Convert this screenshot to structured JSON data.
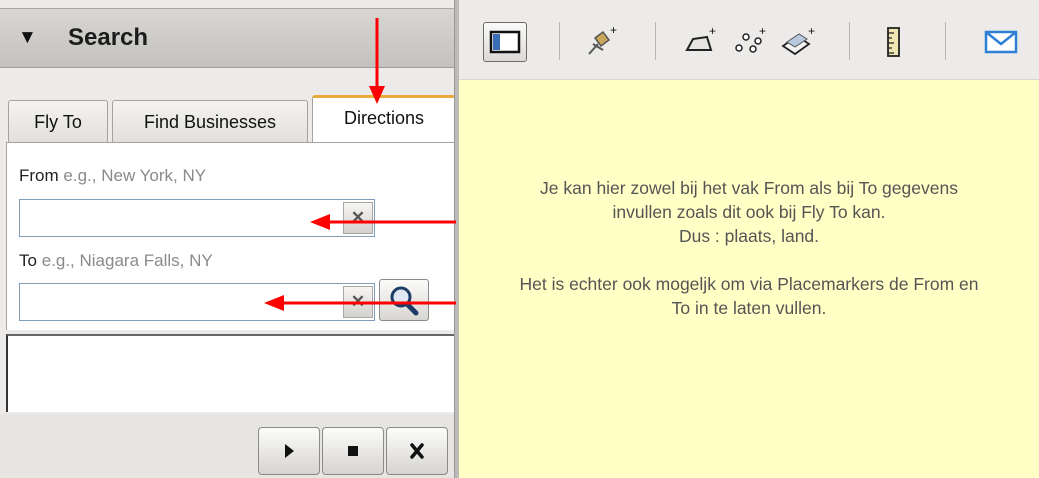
{
  "search_panel": {
    "title": "Search",
    "tabs": [
      "Fly To",
      "Find Businesses",
      "Directions"
    ],
    "active_tab": "Directions",
    "from": {
      "label": "From",
      "hint": "e.g., New York, NY",
      "value": ""
    },
    "to": {
      "label": "To",
      "hint": "e.g., Niagara Falls, NY",
      "value": ""
    }
  },
  "icons": {
    "collapse": "triangle-down-icon",
    "dropdown_clear": "x-icon",
    "search": "magnifier-icon",
    "play": "play-icon",
    "stop": "stop-icon",
    "close": "close-icon"
  },
  "toolbar": {
    "buttons": [
      "sidebar-toggle-icon",
      "add-placemark-icon",
      "add-polygon-icon",
      "add-path-icon",
      "add-image-overlay-icon",
      "ruler-icon",
      "email-icon"
    ]
  },
  "note": {
    "lines": [
      "Je kan hier zowel bij het vak From als bij To  gegevens",
      "invullen zoals dit ook bij Fly To kan.",
      "Dus : plaats, land.",
      "",
      "Het is echter ook mogeljk om via Placemarkers de From en",
      "To in te laten vullen."
    ]
  },
  "colors": {
    "note_background": "#ffffc6",
    "arrow": "#ff0000",
    "active_tab_accent": "#e9ac3c"
  }
}
